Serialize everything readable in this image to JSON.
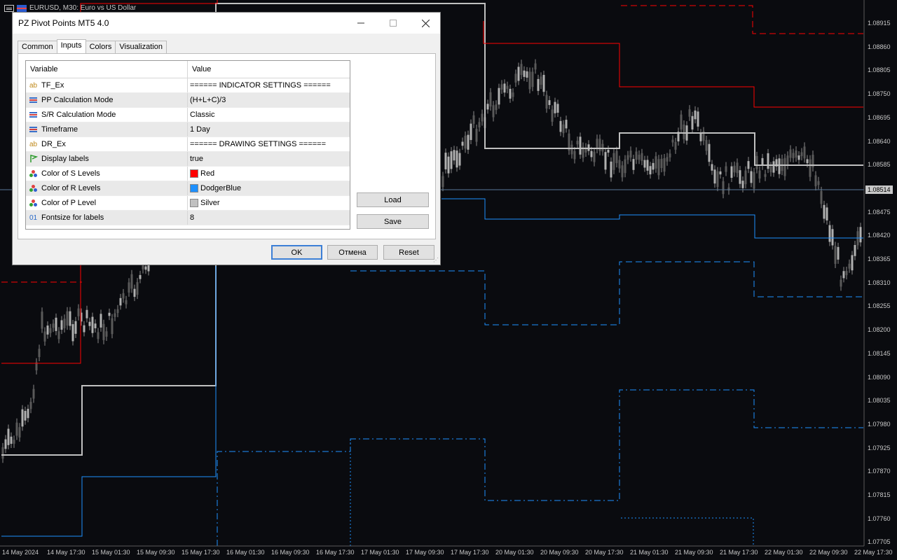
{
  "chart": {
    "title": "EURUSD, M30: Euro vs US Dollar",
    "current_price": "1.08514",
    "price_axis": [
      "1.08915",
      "1.08860",
      "1.08805",
      "1.08750",
      "1.08695",
      "1.08640",
      "1.08585",
      "1.08530",
      "1.08475",
      "1.08420",
      "1.08365",
      "1.08310",
      "1.08255",
      "1.08200",
      "1.08145",
      "1.08090",
      "1.08035",
      "1.07980",
      "1.07925",
      "1.07870",
      "1.07815",
      "1.07760",
      "1.07705"
    ],
    "time_axis": [
      "14 May 2024",
      "14 May 17:30",
      "15 May 01:30",
      "15 May 09:30",
      "15 May 17:30",
      "16 May 01:30",
      "16 May 09:30",
      "16 May 17:30",
      "17 May 01:30",
      "17 May 09:30",
      "17 May 17:30",
      "20 May 01:30",
      "20 May 09:30",
      "20 May 17:30",
      "21 May 01:30",
      "21 May 09:30",
      "21 May 17:30",
      "22 May 01:30",
      "22 May 09:30",
      "22 May 17:30"
    ],
    "colors": {
      "background": "#0a0b0f",
      "s_levels": "#ff0000",
      "r_levels": "#1e90ff",
      "p_level": "#c0c0c0",
      "candles": "#8a8a8a"
    }
  },
  "dialog": {
    "title": "PZ Pivot Points MT5 4.0",
    "tabs": [
      "Common",
      "Inputs",
      "Colors",
      "Visualization"
    ],
    "active_tab": "Inputs",
    "grid": {
      "headers": [
        "Variable",
        "Value"
      ],
      "rows": [
        {
          "icon": "ab-icon",
          "variable": "TF_Ex",
          "value": "====== INDICATOR SETTINGS ======"
        },
        {
          "icon": "list-icon",
          "variable": "PP Calculation Mode",
          "value": "(H+L+C)/3"
        },
        {
          "icon": "list-icon",
          "variable": "S/R Calculation Mode",
          "value": "Classic"
        },
        {
          "icon": "list-icon",
          "variable": "Timeframe",
          "value": "1 Day"
        },
        {
          "icon": "ab-icon",
          "variable": "DR_Ex",
          "value": "====== DRAWING SETTINGS ======"
        },
        {
          "icon": "flag-icon",
          "variable": "Display labels",
          "value": "true"
        },
        {
          "icon": "color-icon",
          "variable": "Color of S Levels",
          "value": "Red",
          "swatch": "#ff0000"
        },
        {
          "icon": "color-icon",
          "variable": "Color of R Levels",
          "value": "DodgerBlue",
          "swatch": "#1e90ff"
        },
        {
          "icon": "color-icon",
          "variable": "Color of P Level",
          "value": "Silver",
          "swatch": "#c0c0c0"
        },
        {
          "icon": "number-icon",
          "variable": "Fontsize for labels",
          "value": "8"
        }
      ]
    },
    "buttons": {
      "load": "Load",
      "save": "Save",
      "ok": "OK",
      "cancel": "Отмена",
      "reset": "Reset"
    }
  }
}
